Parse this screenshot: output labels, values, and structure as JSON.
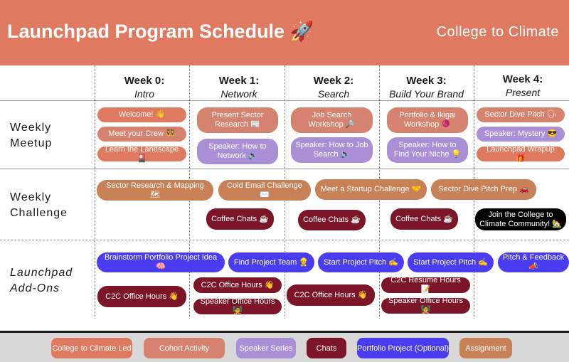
{
  "header": {
    "title": "Launchpad Program Schedule 🚀",
    "subtitle": "College to Climate"
  },
  "weeks": [
    {
      "week": "Week 0:",
      "subtitle": "Intro"
    },
    {
      "week": "Week 1:",
      "subtitle": "Network"
    },
    {
      "week": "Week 2:",
      "subtitle": "Search"
    },
    {
      "week": "Week 3:",
      "subtitle": "Build Your Brand"
    },
    {
      "week": "Week 4:",
      "subtitle": "Present"
    }
  ],
  "rows": {
    "meetup": "Weekly\nMeetup",
    "challenge": "Weekly\nChallenge",
    "addons": "Launchpad\nAdd-Ons"
  },
  "meetup": {
    "welcome": "Welcome! 👋",
    "meet_crew": "Meet your Crew 👯",
    "landscape": "Learn the Landscape 🎴",
    "present_research": "Present Sector Research 📰",
    "speaker_network": "Speaker: How to Network 🔈",
    "job_search": "Job Search Workshop 🔎",
    "speaker_job": "Speaker: How to Job Search 🔈",
    "portfolio_ikigai": "Portfolio & Ikigai Workshop 🧶",
    "speaker_niche": "Speaker: How to Find Your Niche 💡",
    "sector_dive": "Sector Dive Pitch 🗣",
    "speaker_mystery": "Speaker:  Mystery 😎",
    "wrapup": "Launchpad Wrapup 🎁"
  },
  "challenge": {
    "sector_research": "Sector Research & Mapping 🗺",
    "cold_email": "Cold Email Challenge ✉️",
    "meet_startup": "Meet a Startup Challenge 🤝",
    "sector_dive_prep": "Sector Dive Pitch Prep 🚗",
    "coffee1": "Coffee Chats ☕",
    "coffee2": "Coffee Chats ☕",
    "coffee3": "Coffee Chats ☕",
    "join": "Join the College to Climate Community! 🏡"
  },
  "addons": {
    "brainstorm": "Brainstorm Portfolio Project Idea 🧠",
    "find_team": "Find Project Team 👷",
    "pitch1": "Start Project Pitch ✍",
    "pitch2": "Start Project Pitch ✍",
    "pitch_feedback": "Pitch & Feedback 📣",
    "office0": "C2C Office Hours 👋",
    "office1": "C2C Office Hours 👋",
    "speaker_office1": "Speaker Office Hours 🧑‍🏫",
    "office2": "C2C Office Hours 👋",
    "resume": "C2C Resume Hours 📝",
    "speaker_office3": "Speaker Office Hours 🧑‍🏫"
  },
  "legend": {
    "c2c": "College to Climate Led",
    "cohort": "Cohort Activity",
    "speaker": "Speaker Series",
    "chats": "Chats",
    "portfolio": "Portfolio Project (Optional)",
    "assignment": "Assignment"
  },
  "colors": {
    "header": "#df7a61",
    "c2c_led": "#df7a61",
    "cohort": "#d5836e",
    "speaker": "#a88fd6",
    "chats": "#7b1527",
    "portfolio": "#4a3cf0",
    "assignment": "#c88056"
  }
}
